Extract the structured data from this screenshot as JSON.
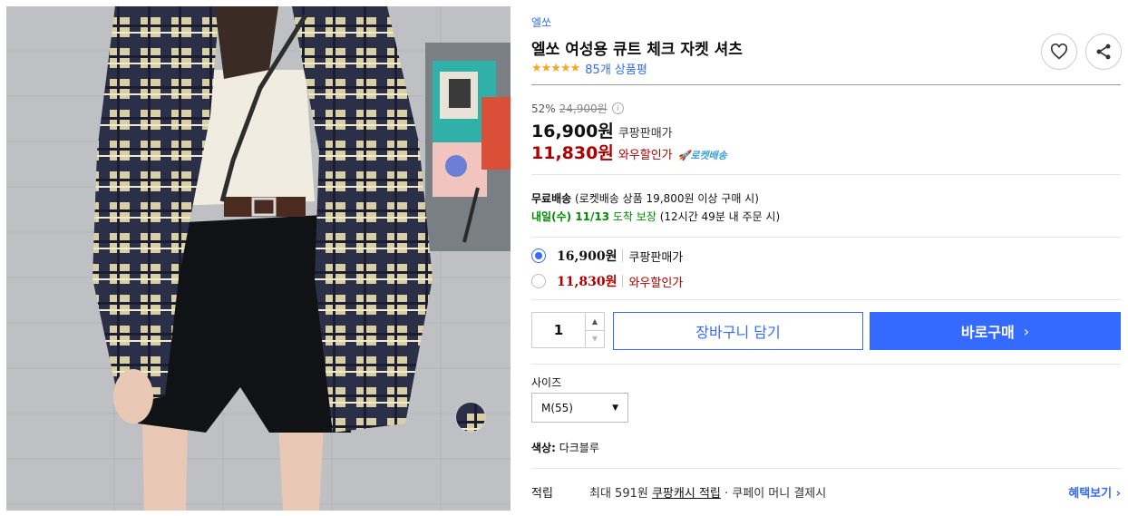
{
  "product": {
    "brand": "엘쏘",
    "title": "엘쏘 여성용 큐트 체크 자켓 셔츠",
    "rating_stars": "★★★★★",
    "rating": 4.5,
    "review_count": "85개 상품평"
  },
  "pricing": {
    "discount_rate": "52%",
    "original_price": "24,900원",
    "sale_price": "16,900원",
    "sale_label": "쿠팡판매가",
    "wow_price": "11,830원",
    "wow_label": "와우할인가",
    "rocket_label": "🚀로켓배송"
  },
  "shipping": {
    "free_label": "무료배송",
    "free_desc": "(로켓배송 상품 19,800원 이상 구매 시)",
    "arrival": "내일(수) 11/13",
    "arrival_suffix": "도착 보장",
    "arrival_note": "(12시간 49분 내 주문 시)"
  },
  "price_options": [
    {
      "price": "16,900원",
      "label": "쿠팡판매가",
      "selected": true
    },
    {
      "price": "11,830원",
      "label": "와우할인가",
      "selected": false
    }
  ],
  "purchase": {
    "quantity": "1",
    "cart_label": "장바구니 담기",
    "buy_label": "바로구매",
    "buy_chevron": "›"
  },
  "options": {
    "size_label": "사이즈",
    "size_value": "M(55)",
    "color_label": "색상:",
    "color_value": "다크블루"
  },
  "points": {
    "label": "적립",
    "desc_prefix": "최대 591원",
    "desc_link": "쿠팡캐시 적립",
    "desc_suffix": "· 쿠페이 머니 결제시",
    "more_label": "혜택보기 ›"
  },
  "colors": {
    "accent": "#346aff",
    "wow_red": "#ae0000",
    "arrival_green": "#008c00",
    "star": "#f5a623"
  }
}
